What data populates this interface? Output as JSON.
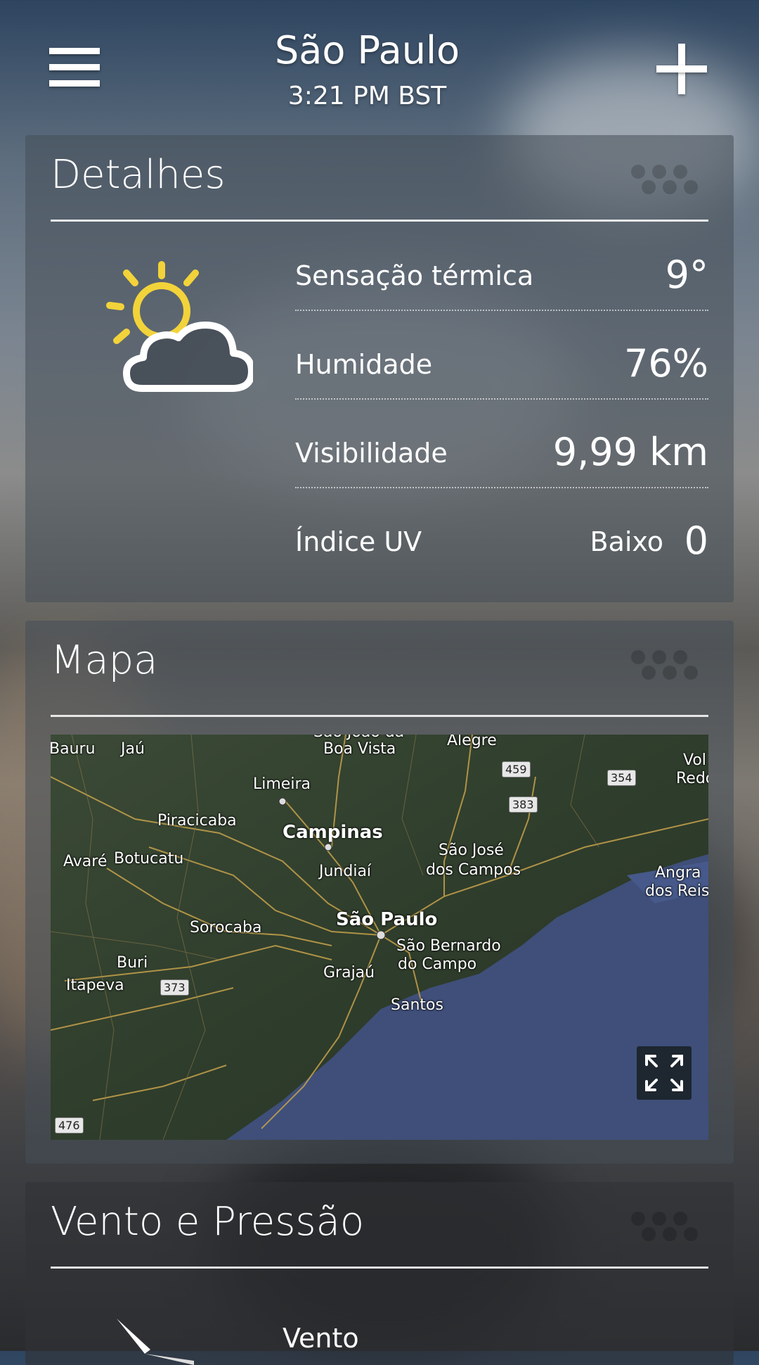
{
  "header": {
    "city": "São Paulo",
    "time": "3:21 PM BST"
  },
  "details": {
    "title": "Detalhes",
    "condition_icon": "partly-cloudy-icon",
    "rows": [
      {
        "label": "Sensação térmica",
        "value": "9°"
      },
      {
        "label": "Humidade",
        "value": "76%"
      },
      {
        "label": "Visibilidade",
        "value": "9,99 km"
      },
      {
        "label": "Índice UV",
        "level": "Baixo",
        "value": "0"
      }
    ]
  },
  "map_card": {
    "title": "Mapa",
    "places": [
      "Bauru",
      "Jaú",
      "São João da",
      "Boa Vista",
      "Alegre",
      "Limeira",
      "Piracicaba",
      "Campinas",
      "Botucatu",
      "Avaré",
      "Jundiaí",
      "São José",
      "dos Campos",
      "Angra",
      "dos Reis",
      "Vol",
      "Redo",
      "São Paulo",
      "Sorocaba",
      "São Bernardo",
      "do Campo",
      "Buri",
      "Grajaú",
      "Itapeva",
      "Santos"
    ],
    "road_shields": [
      "459",
      "354",
      "383",
      "373",
      "476"
    ],
    "expand_icon": "expand-icon"
  },
  "wind_card": {
    "title": "Vento e Pressão",
    "wind_label": "Vento"
  },
  "colors": {
    "sun": "#f2d33a",
    "card": "#464e58",
    "ocean": "#3f4f7a",
    "land": "#344130",
    "road": "#c5a24b"
  }
}
